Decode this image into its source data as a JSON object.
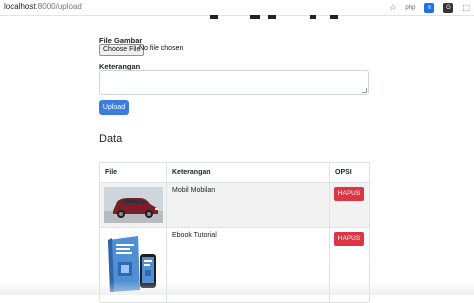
{
  "browser": {
    "url_host": "localhost",
    "url_path": ":8000/upload",
    "icons": [
      "star-icon",
      "php-extension-icon",
      "list-extension-icon",
      "translate-extension-icon",
      "extension-icon"
    ],
    "ext_php_label": "php"
  },
  "form": {
    "file_label": "File Gambar",
    "file_button": "Choose File",
    "file_status": "No file chosen",
    "desc_label": "Keterangan",
    "desc_value": "",
    "submit_label": "Upload"
  },
  "data_section": {
    "title": "Data"
  },
  "table": {
    "headers": [
      "File",
      "Keterangan",
      "OPSI"
    ],
    "rows": [
      {
        "keterangan": "Mobil Mobilan",
        "action": "HAPUS",
        "image": "red-car-photo"
      },
      {
        "keterangan": "Ebook Tutorial",
        "action": "HAPUS",
        "image": "ebook-cover"
      }
    ]
  },
  "colors": {
    "primary": "#3b7ddd",
    "danger": "#dc3545",
    "striped_row": "#f2f2f2"
  }
}
